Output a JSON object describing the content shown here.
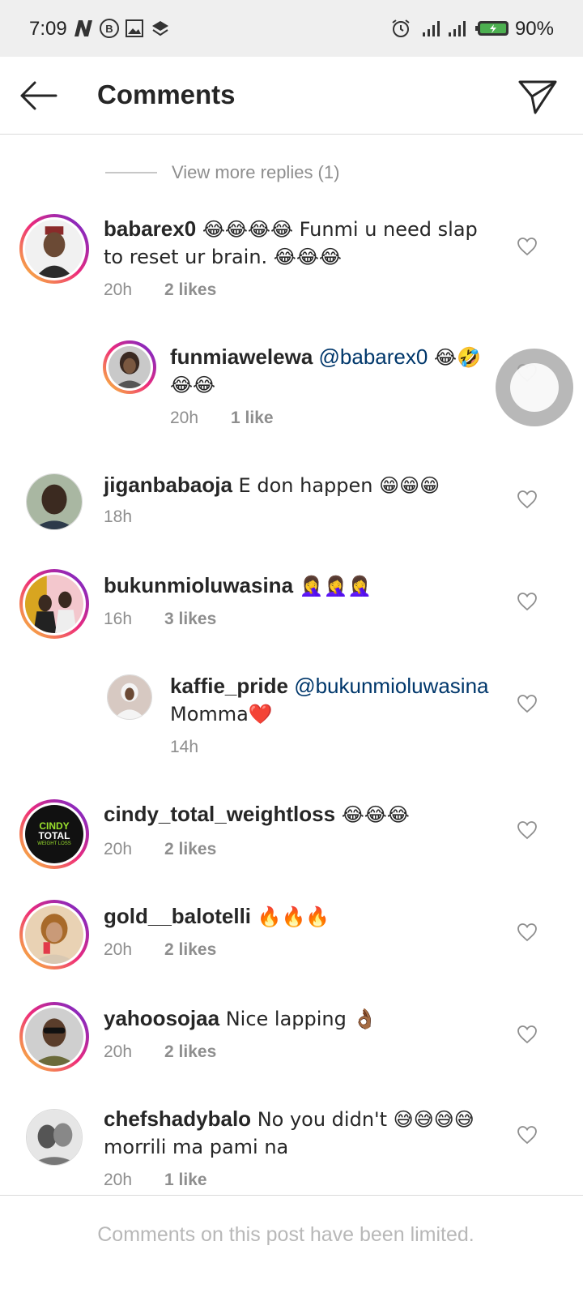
{
  "status_bar": {
    "time": "7:09",
    "battery": "90%",
    "icons": [
      "netflix-n-icon",
      "b-badge-icon",
      "gallery-icon",
      "layers-icon",
      "alarm-icon",
      "signal-icon",
      "signal-icon",
      "battery-charging-icon"
    ]
  },
  "header": {
    "title": "Comments",
    "back_icon": "arrow-left-icon",
    "send_icon": "paper-plane-icon"
  },
  "view_more_replies": "View more replies (1)",
  "comments": [
    {
      "user": "babarex0",
      "text": " 😂😂😂😂 Funmi u need slap to reset ur brain. 😂😂😂",
      "time": "20h",
      "likes": "2 likes"
    },
    {
      "user": "funmiawelewa",
      "mention": "@babarex0",
      "text": " 😂🤣😂😂",
      "time": "20h",
      "likes": "1 like"
    },
    {
      "user": "jiganbabaoja",
      "text": " E don happen 😁😁😁",
      "time": "18h",
      "likes": ""
    },
    {
      "user": "bukunmioluwasina",
      "text": " 🤦‍♀️🤦‍♀️🤦‍♀️",
      "time": "16h",
      "likes": "3 likes"
    },
    {
      "user": "kaffie_pride",
      "mention": "@bukunmioluwasina",
      "text": " Momma❤️",
      "time": "14h",
      "likes": ""
    },
    {
      "user": "cindy_total_weightloss",
      "text": " 😂😂😂",
      "time": "20h",
      "likes": "2 likes"
    },
    {
      "user": "gold__balotelli",
      "text": " 🔥🔥🔥",
      "time": "20h",
      "likes": "2 likes"
    },
    {
      "user": "yahoosojaa",
      "text": " Nice lapping 👌🏾",
      "time": "20h",
      "likes": "2 likes"
    },
    {
      "user": "chefshadybalo",
      "text": " No you didn't 😅😅😅😅 morrili ma pami na",
      "time": "20h",
      "likes": "1 like"
    }
  ],
  "avatar_logo": {
    "line1": "CINDY",
    "line2": "TOTAL",
    "line3": "WEIGHT LOSS"
  },
  "footer": "Comments on this post have been limited.",
  "colors": {
    "text": "#262626",
    "secondary": "#8e8e8e",
    "mention": "#00376b",
    "ring_start": "#f9ce34",
    "ring_mid": "#ee2a7b",
    "ring_end": "#6228d7"
  }
}
